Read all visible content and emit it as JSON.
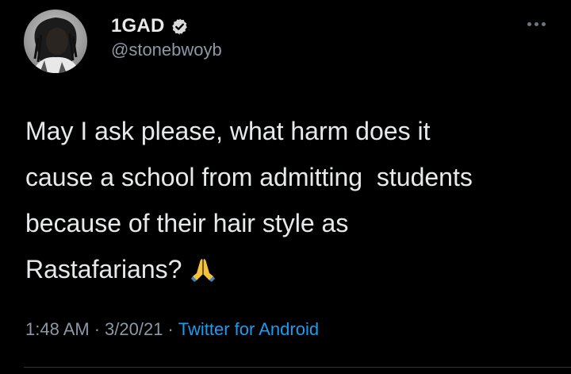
{
  "author": {
    "display_name": "1GAD",
    "handle": "@stonebwoyb",
    "verified": true,
    "avatar_icon": "profile-photo"
  },
  "tweet": {
    "lines": [
      "May I ask please, what harm does it",
      "cause a school from admitting  students",
      "because of their hair style as",
      "Rastafarians?"
    ],
    "emoji": "🙏",
    "emoji_icon": "folded-hands-icon"
  },
  "meta": {
    "time": "1:48 AM",
    "separator": "·",
    "date": "3/20/21",
    "source": "Twitter for Android"
  },
  "colors": {
    "background": "#000000",
    "text": "#e7e9ea",
    "secondary": "#8b98a5",
    "link": "#1d9bf0",
    "verified": "#d9d9d9"
  },
  "icons": {
    "more": "more-horizontal-icon",
    "verified": "verified-badge-icon"
  }
}
